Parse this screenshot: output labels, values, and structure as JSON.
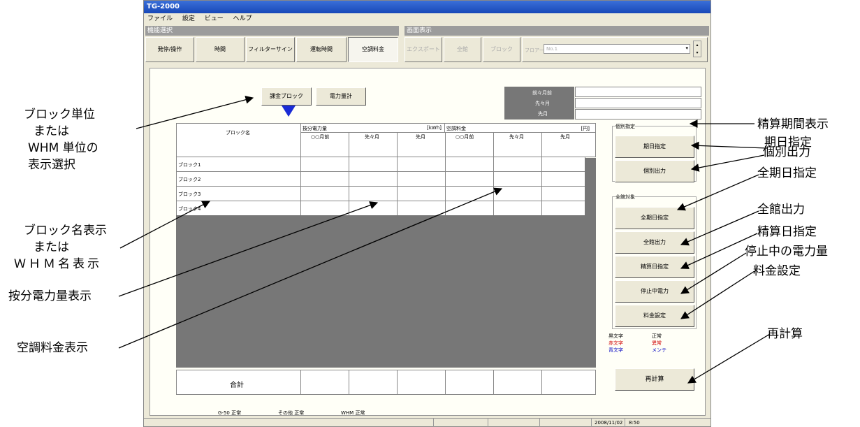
{
  "window": {
    "title": "TG-2000",
    "menu": [
      "ファイル",
      "設定",
      "ビュー",
      "ヘルプ"
    ],
    "section_func": "機能選択",
    "section_view": "画面表示"
  },
  "tabs": [
    "発停/操作",
    "時間",
    "フィルターサイン",
    "運転時間",
    "空調料金"
  ],
  "view_buttons": [
    "エクスポート",
    "全館",
    "ブロック"
  ],
  "floor": {
    "label": "フロアー",
    "value": "No.1"
  },
  "panel": {
    "btn_block": "課金ブロック",
    "btn_meter": "電力量計",
    "period_rows": [
      "前々月前",
      "先々月",
      "先月"
    ],
    "table": {
      "col_block": "ブロック名",
      "group_power": "按分電力量",
      "unit_power": "[kWh]",
      "group_fee": "空調料金",
      "unit_fee": "[円]",
      "sub_headers": [
        "○○月前",
        "先々月",
        "先月",
        "○○月前",
        "先々月",
        "先月"
      ],
      "rows": [
        "ブロック1",
        "ブロック2",
        "ブロック3",
        "ブロック4"
      ],
      "total": "合計"
    },
    "group_individual": "個別指定",
    "btn_date": "期日指定",
    "btn_output": "個別出力",
    "group_all": "全館対象",
    "btn_all_date": "全期日指定",
    "btn_all_output": "全館出力",
    "btn_settle_date": "精算日指定",
    "btn_stop_power": "停止中電力",
    "btn_fee_setting": "料金設定",
    "legend": [
      {
        "label": "黒文字",
        "text": "正常",
        "color": "#000000"
      },
      {
        "label": "赤文字",
        "text": "異常",
        "color": "#d00000"
      },
      {
        "label": "青文字",
        "text": "メンテ",
        "color": "#0000c0"
      }
    ],
    "btn_recalc": "再計算",
    "status": [
      "G-50 正常",
      "その他 正常",
      "WHM 正常"
    ]
  },
  "statusbar": {
    "date": "2008/11/02",
    "time": "8:50"
  },
  "annotations": {
    "block_select": [
      "ブロック単位",
      "または",
      "WHM 単位の",
      "表示選択"
    ],
    "block_name": [
      "ブロック名表示",
      "または",
      "ＷＨＭ名表示"
    ],
    "power": "按分電力量表示",
    "fee": "空調料金表示",
    "period": "精算期間表示",
    "date": "期日指定",
    "output": "個別出力",
    "all_date": "全期日指定",
    "all_output": "全館出力",
    "settle": "精算日指定",
    "stop": "停止中の電力量",
    "fee_set": "料金設定",
    "recalc": "再計算"
  }
}
